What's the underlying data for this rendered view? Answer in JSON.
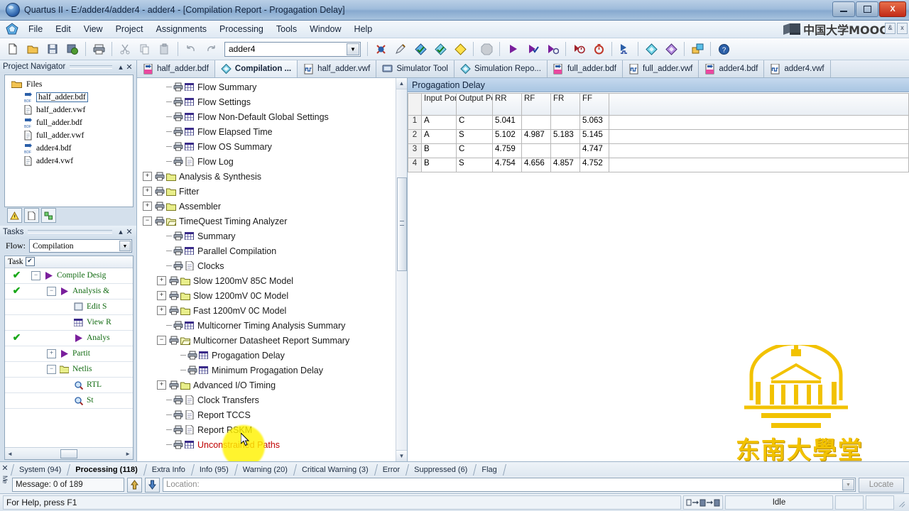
{
  "window": {
    "title": "Quartus II - E:/adder4/adder4 - adder4 - [Compilation Report - Progagation Delay]",
    "minimize_label": "",
    "maximize_label": "",
    "close_label": "X"
  },
  "menubar": {
    "items": [
      "File",
      "Edit",
      "View",
      "Project",
      "Assignments",
      "Processing",
      "Tools",
      "Window",
      "Help"
    ],
    "brand_text": "中国大学MOOC",
    "mdi_restore": "&",
    "mdi_close": "x"
  },
  "toolbar": {
    "project_combo_value": "adder4"
  },
  "project_navigator": {
    "title": "Project Navigator",
    "pin": "▴",
    "close": "✕",
    "root": "Files",
    "files": [
      {
        "name": "half_adder.bdf",
        "type": "bdf",
        "selected": true
      },
      {
        "name": "half_adder.vwf",
        "type": "vwf",
        "selected": false
      },
      {
        "name": "full_adder.bdf",
        "type": "bdf",
        "selected": false
      },
      {
        "name": "full_adder.vwf",
        "type": "vwf",
        "selected": false
      },
      {
        "name": "adder4.bdf",
        "type": "bdf",
        "selected": false
      },
      {
        "name": "adder4.vwf",
        "type": "vwf",
        "selected": false
      }
    ]
  },
  "tasks": {
    "title": "Tasks",
    "pin": "▴",
    "close": "✕",
    "flow_label": "Flow:",
    "flow_value": "Compilation",
    "column_header": "Task",
    "rows": [
      {
        "check": "✔",
        "indent": 0,
        "toggle": "−",
        "icon": "play",
        "label": "Compile Desig"
      },
      {
        "check": "✔",
        "indent": 1,
        "toggle": "−",
        "icon": "play",
        "label": "Analysis &"
      },
      {
        "check": "",
        "indent": 2,
        "toggle": "",
        "icon": "box",
        "label": "Edit S"
      },
      {
        "check": "",
        "indent": 2,
        "toggle": "",
        "icon": "grid",
        "label": "View R"
      },
      {
        "check": "✔",
        "indent": 2,
        "toggle": "",
        "icon": "play",
        "label": "Analys"
      },
      {
        "check": "",
        "indent": 1,
        "toggle": "+",
        "icon": "play",
        "label": "Partit"
      },
      {
        "check": "",
        "indent": 1,
        "toggle": "−",
        "icon": "folder",
        "label": "Netlis"
      },
      {
        "check": "",
        "indent": 2,
        "toggle": "",
        "icon": "magnifier",
        "label": "RTL"
      },
      {
        "check": "",
        "indent": 2,
        "toggle": "",
        "icon": "magnifier",
        "label": "St"
      }
    ]
  },
  "doc_tabs": [
    {
      "label": "half_adder.bdf",
      "icon": "bdf-icon",
      "active": false
    },
    {
      "label": "Compilation ...",
      "icon": "report-icon",
      "active": true
    },
    {
      "label": "half_adder.vwf",
      "icon": "vwf-icon",
      "active": false
    },
    {
      "label": "Simulator Tool",
      "icon": "simulator-icon",
      "active": false
    },
    {
      "label": "Simulation Repo...",
      "icon": "report-icon",
      "active": false
    },
    {
      "label": "full_adder.bdf",
      "icon": "bdf-icon",
      "active": false
    },
    {
      "label": "full_adder.vwf",
      "icon": "vwf-icon",
      "active": false
    },
    {
      "label": "adder4.bdf",
      "icon": "bdf-icon",
      "active": false
    },
    {
      "label": "adder4.vwf",
      "icon": "vwf-icon",
      "active": false
    }
  ],
  "report_tree": [
    {
      "label": "Flow Summary",
      "indent": 1,
      "toggle": "",
      "icon": "table-report",
      "selected": false
    },
    {
      "label": "Flow Settings",
      "indent": 1,
      "toggle": "",
      "icon": "table-report",
      "selected": false
    },
    {
      "label": "Flow Non-Default Global Settings",
      "indent": 1,
      "toggle": "",
      "icon": "table-report",
      "selected": false
    },
    {
      "label": "Flow Elapsed Time",
      "indent": 1,
      "toggle": "",
      "icon": "table-report",
      "selected": false
    },
    {
      "label": "Flow OS Summary",
      "indent": 1,
      "toggle": "",
      "icon": "table-report",
      "selected": false
    },
    {
      "label": "Flow Log",
      "indent": 1,
      "toggle": "",
      "icon": "doc-report",
      "selected": false
    },
    {
      "label": "Analysis & Synthesis",
      "indent": 0,
      "toggle": "+",
      "icon": "folder-report",
      "selected": false
    },
    {
      "label": "Fitter",
      "indent": 0,
      "toggle": "+",
      "icon": "folder-report",
      "selected": false
    },
    {
      "label": "Assembler",
      "indent": 0,
      "toggle": "+",
      "icon": "folder-report",
      "selected": false
    },
    {
      "label": "TimeQuest Timing Analyzer",
      "indent": 0,
      "toggle": "−",
      "icon": "folder-open-report",
      "selected": false
    },
    {
      "label": "Summary",
      "indent": 1,
      "toggle": "",
      "icon": "table-report",
      "selected": false
    },
    {
      "label": "Parallel Compilation",
      "indent": 1,
      "toggle": "",
      "icon": "table-report",
      "selected": false
    },
    {
      "label": "Clocks",
      "indent": 1,
      "toggle": "",
      "icon": "doc-report",
      "selected": false
    },
    {
      "label": "Slow 1200mV 85C Model",
      "indent": 1,
      "toggle": "+",
      "icon": "folder-report",
      "selected": false
    },
    {
      "label": "Slow 1200mV 0C Model",
      "indent": 1,
      "toggle": "+",
      "icon": "folder-report",
      "selected": false
    },
    {
      "label": "Fast 1200mV 0C Model",
      "indent": 1,
      "toggle": "+",
      "icon": "folder-report",
      "selected": false
    },
    {
      "label": "Multicorner Timing Analysis Summary",
      "indent": 1,
      "toggle": "",
      "icon": "table-report",
      "selected": false
    },
    {
      "label": "Multicorner Datasheet Report Summary",
      "indent": 1,
      "toggle": "−",
      "icon": "folder-open-report",
      "selected": false
    },
    {
      "label": "Progagation Delay",
      "indent": 2,
      "toggle": "",
      "icon": "table-report",
      "selected": true
    },
    {
      "label": "Minimum Progagation Delay",
      "indent": 2,
      "toggle": "",
      "icon": "table-report",
      "selected": false
    },
    {
      "label": "Advanced I/O Timing",
      "indent": 1,
      "toggle": "+",
      "icon": "folder-report",
      "selected": false
    },
    {
      "label": "Clock Transfers",
      "indent": 1,
      "toggle": "",
      "icon": "doc-report",
      "selected": false
    },
    {
      "label": "Report TCCS",
      "indent": 1,
      "toggle": "",
      "icon": "doc-report",
      "selected": false
    },
    {
      "label": "Report RSKM",
      "indent": 1,
      "toggle": "",
      "icon": "doc-report",
      "selected": false
    },
    {
      "label": "Unconstrained Paths",
      "indent": 1,
      "toggle": "",
      "icon": "table-report",
      "selected": false,
      "red": true
    }
  ],
  "report": {
    "title": "Progagation Delay",
    "columns": [
      "",
      "Input Port",
      "Output Port",
      "RR",
      "RF",
      "FR",
      "FF",
      ""
    ],
    "rows": [
      {
        "index": "1",
        "input_port": "A",
        "output_port": "C",
        "rr": "5.041",
        "rf": "",
        "fr": "",
        "ff": "5.063",
        "extra": ""
      },
      {
        "index": "2",
        "input_port": "A",
        "output_port": "S",
        "rr": "5.102",
        "rf": "4.987",
        "fr": "5.183",
        "ff": "5.145",
        "extra": ""
      },
      {
        "index": "3",
        "input_port": "B",
        "output_port": "C",
        "rr": "4.759",
        "rf": "",
        "fr": "",
        "ff": "4.747",
        "extra": ""
      },
      {
        "index": "4",
        "input_port": "B",
        "output_port": "S",
        "rr": "4.754",
        "rf": "4.656",
        "fr": "4.857",
        "ff": "4.752",
        "extra": ""
      }
    ]
  },
  "messages": {
    "close": "✕",
    "side_label": "Me",
    "tabs": [
      {
        "label": "System (94)",
        "active": false
      },
      {
        "label": "Processing (118)",
        "active": true
      },
      {
        "label": "Extra Info",
        "active": false
      },
      {
        "label": "Info (95)",
        "active": false
      },
      {
        "label": "Warning (20)",
        "active": false
      },
      {
        "label": "Critical Warning (3)",
        "active": false
      },
      {
        "label": "Error",
        "active": false
      },
      {
        "label": "Suppressed (6)",
        "active": false
      },
      {
        "label": "Flag",
        "active": false
      }
    ],
    "message_counter": "Message: 0 of 189",
    "location_placeholder": "Location:",
    "locate_button": "Locate"
  },
  "statusbar": {
    "help_text": "For Help, press F1",
    "state": "Idle"
  },
  "watermark": {
    "text": "东南大學堂"
  },
  "colors": {
    "accent": "#3b6ea5",
    "highlight": "#fff200",
    "title_gradient_start": "#b9cfe6",
    "report_title_bar": "#a9c6e2",
    "task_green": "#126b12",
    "red_item": "#c00000",
    "watermark_gold": "#f2c200"
  }
}
